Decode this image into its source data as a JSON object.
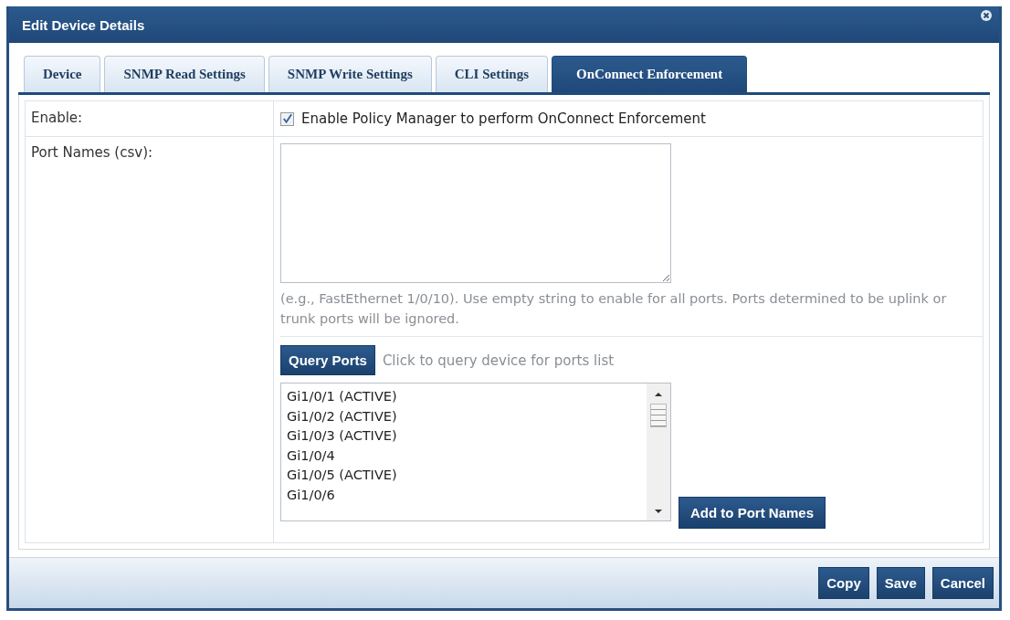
{
  "window": {
    "title": "Edit Device Details"
  },
  "tabs": [
    {
      "label": "Device",
      "selected": false
    },
    {
      "label": "SNMP Read Settings",
      "selected": false
    },
    {
      "label": "SNMP Write Settings",
      "selected": false
    },
    {
      "label": "CLI Settings",
      "selected": false
    },
    {
      "label": "OnConnect Enforcement",
      "selected": true
    }
  ],
  "enable": {
    "label": "Enable:",
    "checked": true,
    "text": "Enable Policy Manager to perform OnConnect Enforcement"
  },
  "port_names": {
    "label": "Port Names (csv):",
    "hint": "(e.g., FastEthernet 1/0/10). Use empty string to enable for all ports. Ports determined to be uplink or trunk ports will be ignored."
  },
  "query": {
    "button": "Query Ports",
    "hint": "Click to query device for ports list"
  },
  "ports": [
    "Gi1/0/1 (ACTIVE)",
    "Gi1/0/2 (ACTIVE)",
    "Gi1/0/3 (ACTIVE)",
    "Gi1/0/4",
    "Gi1/0/5 (ACTIVE)",
    "Gi1/0/6"
  ],
  "add_button": "Add to Port Names",
  "buttons": [
    "Copy",
    "Save",
    "Cancel"
  ]
}
